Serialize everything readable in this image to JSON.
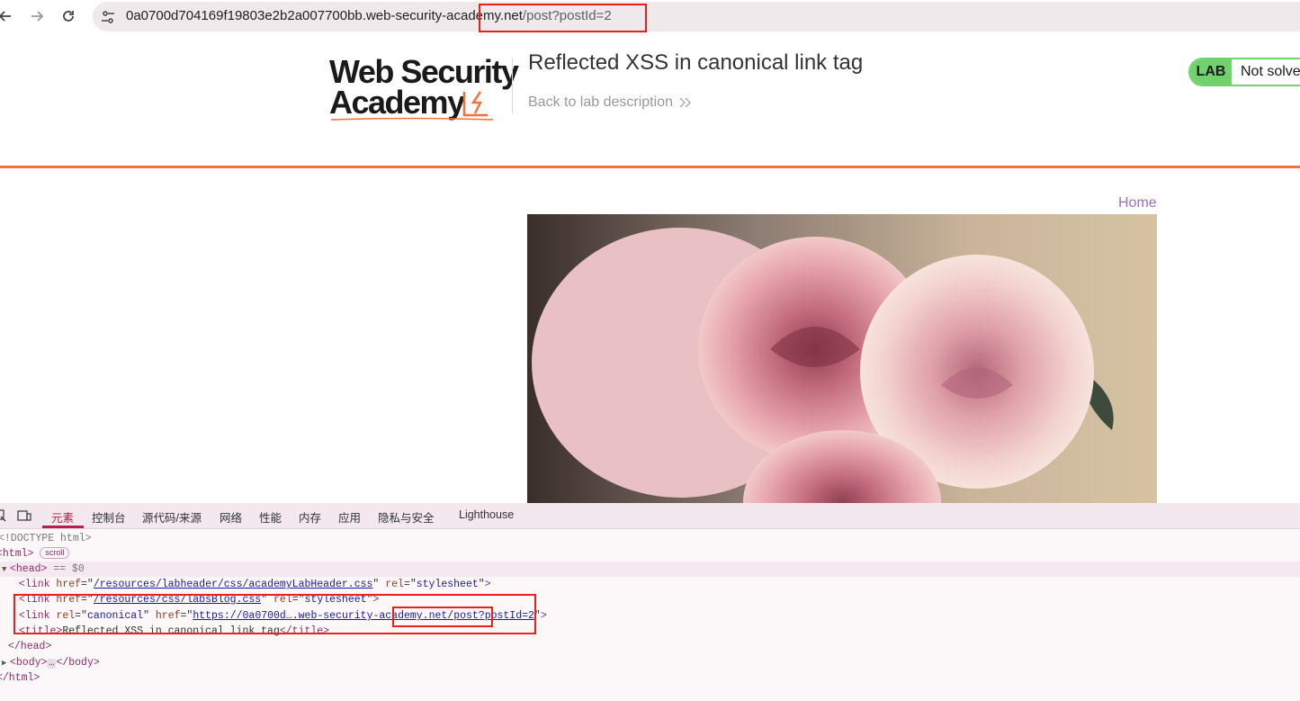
{
  "browser": {
    "url_host": "0a0700d704169f19803e2b2a007700bb.web-security-acade",
    "url_host_tail": "my.net",
    "url_path": "/post?postId=2"
  },
  "lab_header": {
    "logo_line1": "Web Security",
    "logo_line2": "Academy",
    "title": "Reflected XSS in canonical link tag",
    "back_link": "Back to lab description",
    "status_badge": "LAB",
    "status_text": "Not solve"
  },
  "page": {
    "home_link": "Home"
  },
  "devtools": {
    "tabs": [
      "元素",
      "控制台",
      "源代码/来源",
      "网络",
      "性能",
      "内存",
      "应用",
      "隐私与安全",
      "Lighthouse"
    ],
    "lines": {
      "doctype": "<!DOCTYPE html>",
      "html_open": "<html>",
      "scroll_pill": "scroll",
      "head_open": "<head>",
      "head_selected": "== $0",
      "link1_href": "/resources/labheader/css/academyLabHeader.css",
      "link1_rel": "stylesheet",
      "link2_href": "/resources/css/labsBlog.css",
      "link2_rel": "stylesheet",
      "canonical_rel": "canonical",
      "canonical_href_start": "https://0a0700d",
      "canonical_href_mid": "…",
      "canonical_href_host": ".web-security-academy.ne",
      "canonical_href_path": "t/post?postId=2",
      "title_text": "Reflected XSS in canonical link tag",
      "head_close": "</head>",
      "body_open": "<body>",
      "body_ellipsis": "…",
      "body_close": "</body>",
      "html_close": "</html>"
    }
  },
  "colors": {
    "accent_orange": "#f5703a",
    "lab_green": "#70d16d",
    "home_link": "#a06cc0",
    "highlight_red": "#e8211a"
  }
}
